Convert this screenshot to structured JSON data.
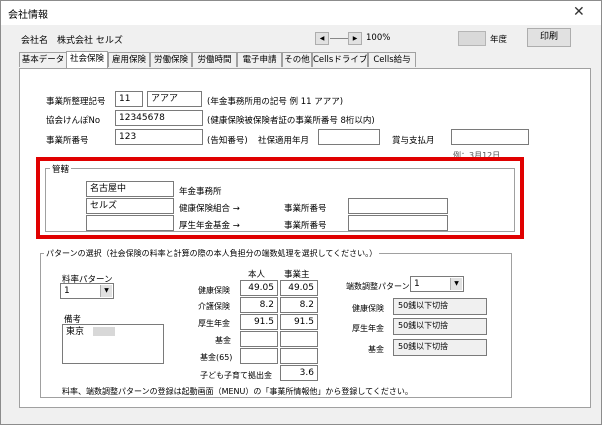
{
  "window": {
    "title": "会社情報",
    "close": "✕"
  },
  "header": {
    "company_label": "会社名",
    "company_name": "株式会社 セルズ",
    "zoom": "100%",
    "year_label": "年度",
    "print_label": "印刷",
    "nav_left": "◀",
    "nav_right": "▶"
  },
  "tabs": [
    "基本データ",
    "社会保険",
    "雇用保険",
    "労働保険",
    "労働時間",
    "電子申請",
    "その他",
    "Cellsドライブ",
    "Cells給与"
  ],
  "form": {
    "office_code_label": "事業所整理記号",
    "office_code_1": "11",
    "office_code_2": "アアア",
    "office_code_note": "(年金事務所用の記号 例 11 アアア)",
    "kyokai_label": "協会けんぽNo",
    "kyokai_value": "12345678",
    "kyokai_note": "(健康保険被保険者証の事業所番号 8桁以内)",
    "office_number_label": "事業所番号",
    "office_number_value": "123",
    "office_number_note": "(告知番号)",
    "shaho_label": "社保適用年月",
    "bonus_label": "賞与支払月",
    "cut_text": "例：3月12日"
  },
  "kankatsu": {
    "title": "管轄",
    "nenkin_value": "名古屋中",
    "nenkin_label": "年金事務所",
    "kenpo_value": "セルズ",
    "kenpo_label": "健康保険組合 →",
    "kenpo_num_label": "事業所番号",
    "kousei_label": "厚生年金基金 →",
    "kousei_num_label": "事業所番号"
  },
  "pattern": {
    "title": "パターンの選択（社会保険の料率と計算の際の本人負担分の端数処理を選択してください。）",
    "rate_label": "料率パターン",
    "rate_value": "1",
    "note_label": "備考",
    "note_value": "東京",
    "col_self": "本人",
    "col_employer": "事業主",
    "rows": [
      {
        "label": "健康保険",
        "self": "49.05",
        "employer": "49.05"
      },
      {
        "label": "介護保険",
        "self": "8.2",
        "employer": "8.2"
      },
      {
        "label": "厚生年金",
        "self": "91.5",
        "employer": "91.5"
      },
      {
        "label": "基金",
        "self": "",
        "employer": ""
      },
      {
        "label": "基金(65)",
        "self": "",
        "employer": ""
      }
    ],
    "child_label": "子ども子育て拠出金",
    "child_value": "3.6",
    "rounding_label": "端数調整パターン",
    "rounding_value": "1",
    "round_rows": [
      {
        "label": "健康保険",
        "value": "50銭以下切捨"
      },
      {
        "label": "厚生年金",
        "value": "50銭以下切捨"
      },
      {
        "label": "基金",
        "value": "50銭以下切捨"
      }
    ],
    "footer": "料率、端数調整パターンの登録は起動画面（MENU）の「事業所情報他」から登録してください。"
  }
}
